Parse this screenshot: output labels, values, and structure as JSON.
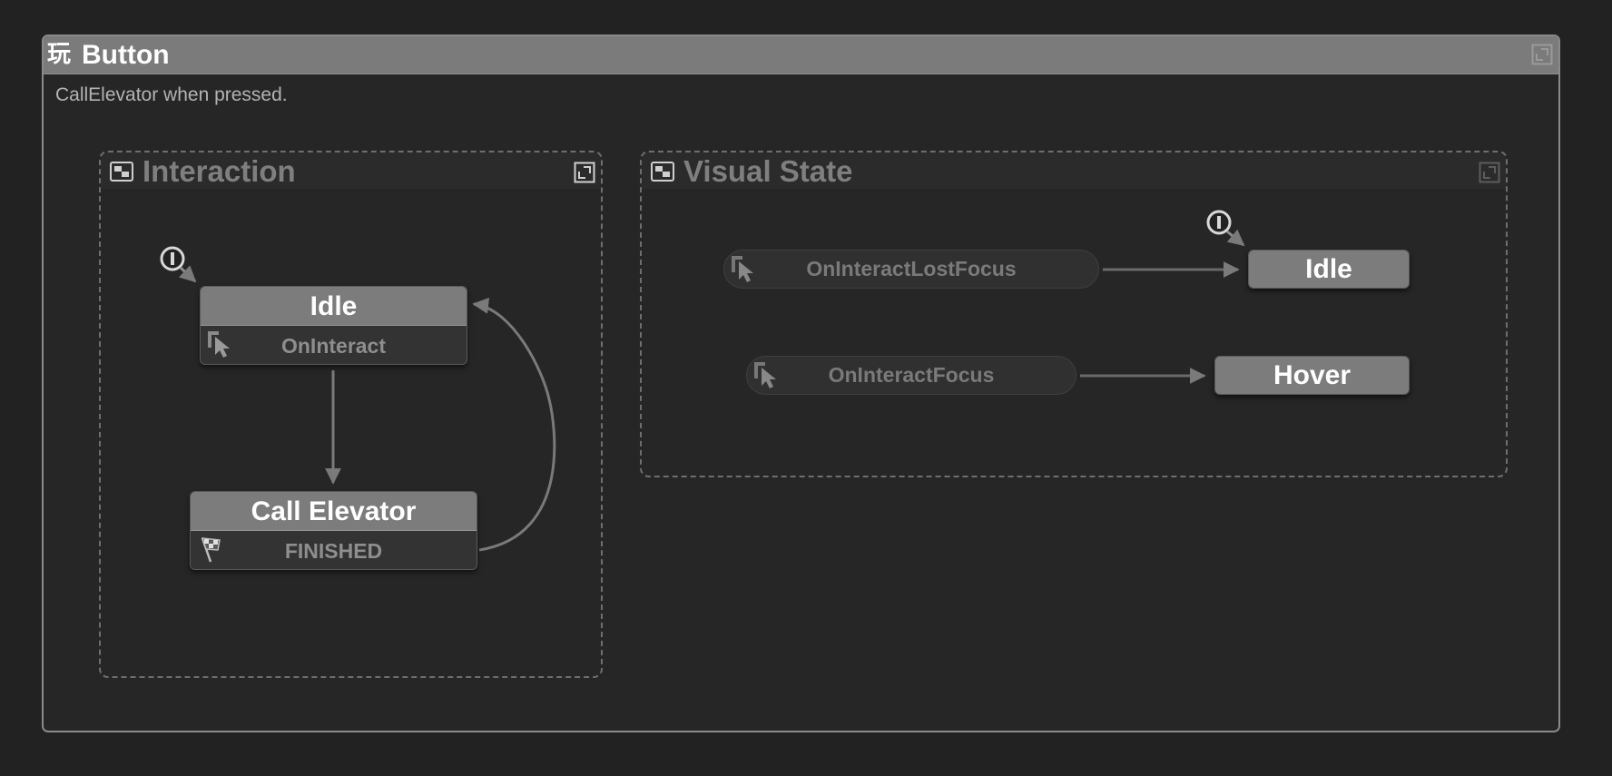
{
  "fsm": {
    "icon": "fsm-glyph-icon",
    "title": "Button",
    "description": "CallElevator when pressed."
  },
  "groups": {
    "interaction": {
      "title": "Interaction",
      "states": {
        "idle": {
          "title": "Idle",
          "event": "OnInteract",
          "event_icon": "cursor-icon"
        },
        "call_elevator": {
          "title": "Call Elevator",
          "event": "FINISHED",
          "event_icon": "checkered-flag-icon"
        }
      }
    },
    "visual_state": {
      "title": "Visual State",
      "global_transitions": [
        {
          "event": "OnInteractLostFocus",
          "icon": "cursor-icon",
          "target": "Idle"
        },
        {
          "event": "OnInteractFocus",
          "icon": "cursor-icon",
          "target": "Hover"
        }
      ],
      "states": {
        "idle": {
          "title": "Idle"
        },
        "hover": {
          "title": "Hover"
        }
      }
    }
  },
  "colors": {
    "background": "#222222",
    "panel": "#262626",
    "header": "#7b7b7b",
    "state_title": "#7c7c7c",
    "state_event": "#333333",
    "arrow": "#7a7a7a"
  }
}
